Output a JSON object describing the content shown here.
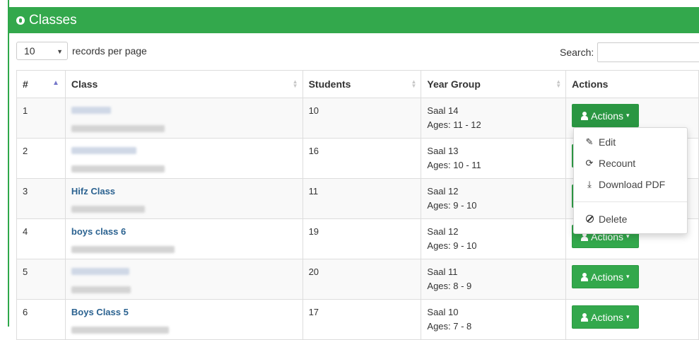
{
  "header": {
    "title": "Classes"
  },
  "length_menu": {
    "value": "10",
    "label": "records per page"
  },
  "search": {
    "label": "Search:",
    "value": ""
  },
  "table": {
    "columns": [
      "#",
      "Class",
      "Students",
      "Year Group",
      "Actions"
    ],
    "rows": [
      {
        "num": "1",
        "name": "",
        "students": "10",
        "year": "Saal 14",
        "ages": "Ages: 11 - 12"
      },
      {
        "num": "2",
        "name": "",
        "students": "16",
        "year": "Saal 13",
        "ages": "Ages: 10 - 11"
      },
      {
        "num": "3",
        "name": "Hifz Class",
        "students": "11",
        "year": "Saal 12",
        "ages": "Ages: 9 - 10"
      },
      {
        "num": "4",
        "name": "boys class 6",
        "students": "19",
        "year": "Saal 12",
        "ages": "Ages: 9 - 10"
      },
      {
        "num": "5",
        "name": "",
        "students": "20",
        "year": "Saal 11",
        "ages": "Ages: 8 - 9"
      },
      {
        "num": "6",
        "name": "Boys Class 5",
        "students": "17",
        "year": "Saal 10",
        "ages": "Ages: 7 - 8"
      }
    ],
    "action_label": "Actions"
  },
  "dropdown": {
    "edit": "Edit",
    "recount": "Recount",
    "download": "Download PDF",
    "delete": "Delete"
  },
  "colors": {
    "brand_green": "#33a84c",
    "link_blue": "#2b6290"
  },
  "icons": [
    "globe-icon",
    "user-icon",
    "chevron-down-icon",
    "sort-icon",
    "pencil-icon",
    "refresh-icon",
    "download-icon",
    "ban-icon"
  ]
}
